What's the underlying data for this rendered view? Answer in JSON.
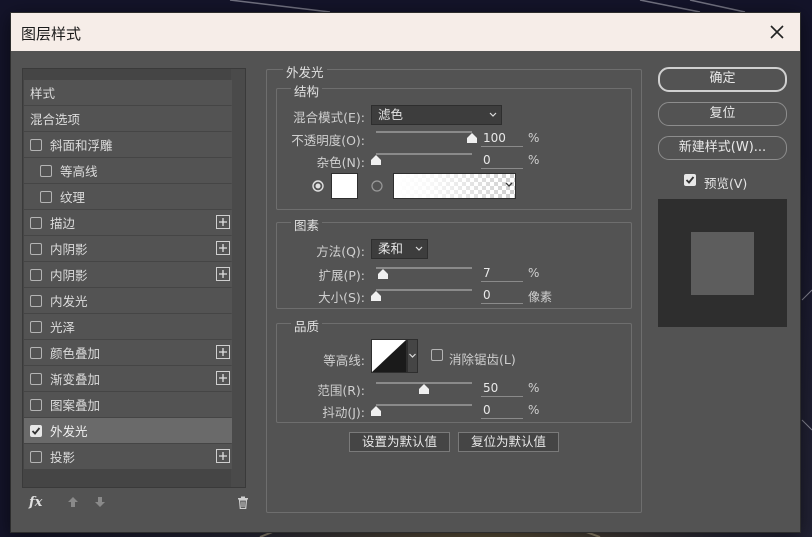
{
  "dialog": {
    "title": "图层样式"
  },
  "style_list": {
    "items": [
      {
        "label": "样式",
        "has_checkbox": false,
        "checked": false,
        "has_plus": false,
        "indent": 0
      },
      {
        "label": "混合选项",
        "has_checkbox": false,
        "checked": false,
        "has_plus": false,
        "indent": 0
      },
      {
        "label": "斜面和浮雕",
        "has_checkbox": true,
        "checked": false,
        "has_plus": false,
        "indent": 0
      },
      {
        "label": "等高线",
        "has_checkbox": true,
        "checked": false,
        "has_plus": false,
        "indent": 1
      },
      {
        "label": "纹理",
        "has_checkbox": true,
        "checked": false,
        "has_plus": false,
        "indent": 1
      },
      {
        "label": "描边",
        "has_checkbox": true,
        "checked": false,
        "has_plus": true,
        "indent": 0
      },
      {
        "label": "内阴影",
        "has_checkbox": true,
        "checked": false,
        "has_plus": true,
        "indent": 0
      },
      {
        "label": "内阴影",
        "has_checkbox": true,
        "checked": false,
        "has_plus": true,
        "indent": 0
      },
      {
        "label": "内发光",
        "has_checkbox": true,
        "checked": false,
        "has_plus": false,
        "indent": 0
      },
      {
        "label": "光泽",
        "has_checkbox": true,
        "checked": false,
        "has_plus": false,
        "indent": 0
      },
      {
        "label": "颜色叠加",
        "has_checkbox": true,
        "checked": false,
        "has_plus": true,
        "indent": 0
      },
      {
        "label": "渐变叠加",
        "has_checkbox": true,
        "checked": false,
        "has_plus": true,
        "indent": 0
      },
      {
        "label": "图案叠加",
        "has_checkbox": true,
        "checked": false,
        "has_plus": false,
        "indent": 0
      },
      {
        "label": "外发光",
        "has_checkbox": true,
        "checked": true,
        "has_plus": false,
        "indent": 0,
        "selected": true
      },
      {
        "label": "投影",
        "has_checkbox": true,
        "checked": false,
        "has_plus": true,
        "indent": 0
      }
    ],
    "fx_label": "fx"
  },
  "outer_glow": {
    "panel_title": "外发光",
    "structure": {
      "legend": "结构",
      "blend_mode_label": "混合模式(E):",
      "blend_mode_value": "滤色",
      "opacity_label": "不透明度(O):",
      "opacity_value": "100",
      "opacity_unit": "%",
      "noise_label": "杂色(N):",
      "noise_value": "0",
      "noise_unit": "%"
    },
    "elements": {
      "legend": "图素",
      "technique_label": "方法(Q):",
      "technique_value": "柔和",
      "spread_label": "扩展(P):",
      "spread_value": "7",
      "spread_unit": "%",
      "size_label": "大小(S):",
      "size_value": "0",
      "size_unit": "像素"
    },
    "quality": {
      "legend": "品质",
      "contour_label": "等高线:",
      "antialias_label": "消除锯齿(L)",
      "range_label": "范围(R):",
      "range_value": "50",
      "range_unit": "%",
      "jitter_label": "抖动(J):",
      "jitter_value": "0",
      "jitter_unit": "%"
    },
    "make_default": "设置为默认值",
    "reset_default": "复位为默认值"
  },
  "buttons": {
    "ok": "确定",
    "reset": "复位",
    "new_style": "新建样式(W)...",
    "preview_label": "预览(V)"
  },
  "colors": {
    "dialog_bg": "#535353",
    "titlebar_bg": "#f6ede8",
    "preview_bg": "#2e2e2e",
    "preview_swatch": "#5d5d5d",
    "glow_color": "#ffffff"
  },
  "values": {
    "opacity": 100,
    "noise": 0,
    "spread": 7,
    "size": 0,
    "range": 50,
    "jitter": 0,
    "preview_checked": true,
    "antialias_checked": false
  }
}
